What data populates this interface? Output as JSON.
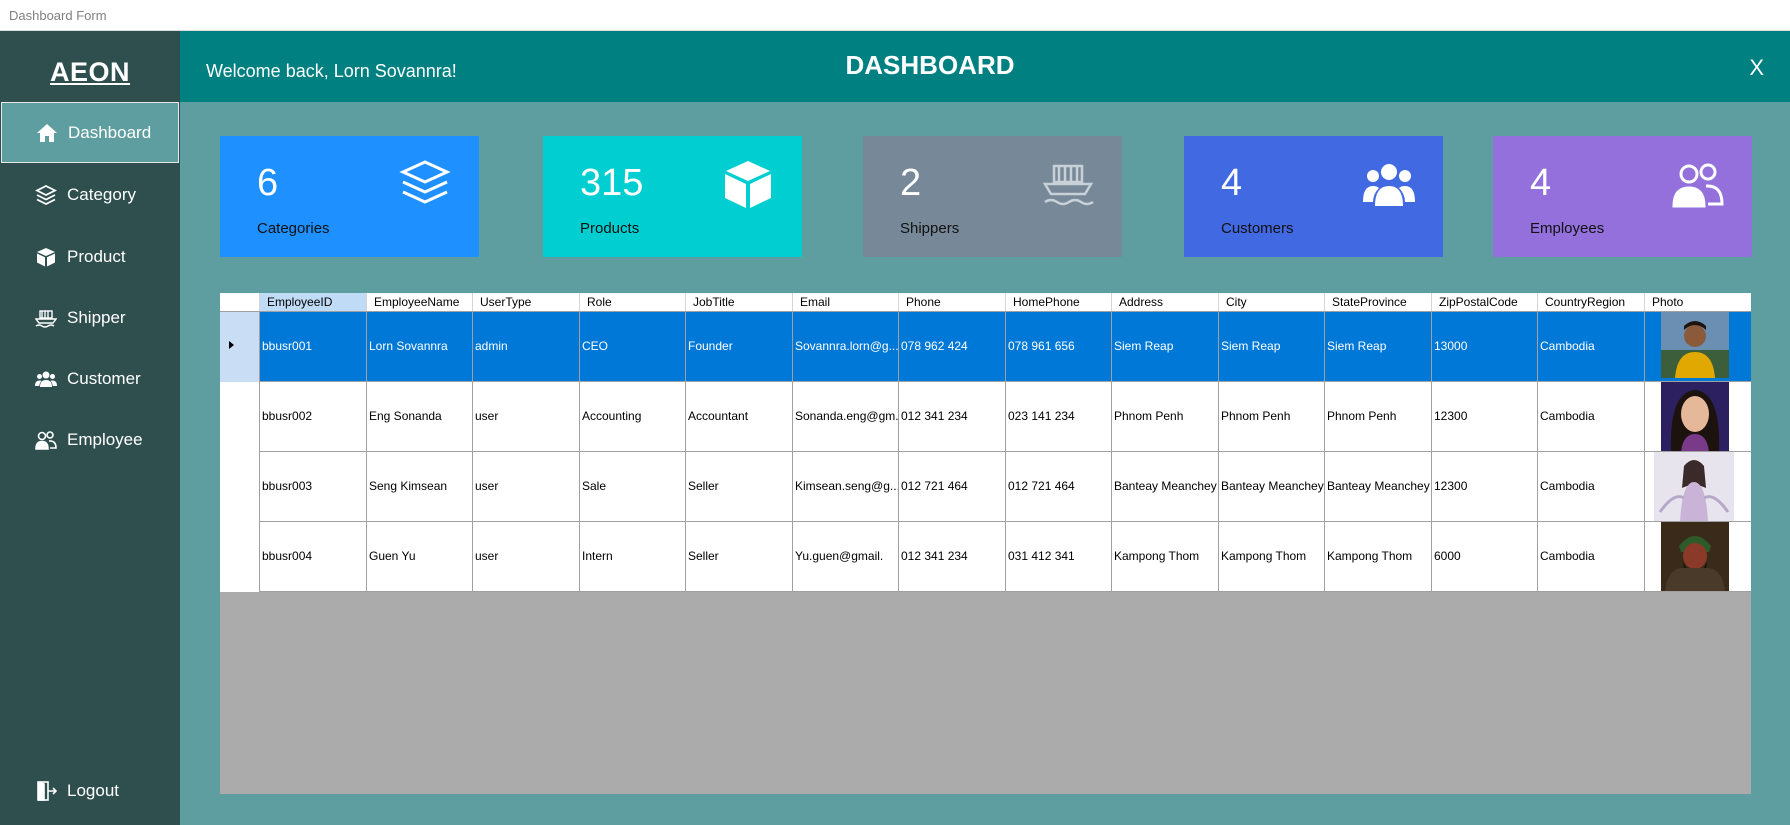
{
  "window": {
    "title": "Dashboard Form"
  },
  "sidebar": {
    "logo": "AEON",
    "items": [
      {
        "label": "Dashboard",
        "icon": "home-icon",
        "active": true
      },
      {
        "label": "Category",
        "icon": "layers-icon"
      },
      {
        "label": "Product",
        "icon": "box-icon"
      },
      {
        "label": "Shipper",
        "icon": "ship-icon"
      },
      {
        "label": "Customer",
        "icon": "users-icon"
      },
      {
        "label": "Employee",
        "icon": "employee-icon"
      }
    ],
    "logout": {
      "label": "Logout",
      "icon": "logout-icon"
    }
  },
  "header": {
    "welcome": "Welcome back, Lorn Sovannra!",
    "title": "DASHBOARD",
    "close": "X"
  },
  "cards": [
    {
      "value": "6",
      "label": "Categories",
      "color": "#1e90ff",
      "icon": "layers-icon"
    },
    {
      "value": "315",
      "label": "Products",
      "color": "#00ced1",
      "icon": "box-icon"
    },
    {
      "value": "2",
      "label": "Shippers",
      "color": "#778899",
      "icon": "ship-icon"
    },
    {
      "value": "4",
      "label": "Customers",
      "color": "#4169e1",
      "icon": "users-icon"
    },
    {
      "value": "4",
      "label": "Employees",
      "color": "#9370db",
      "icon": "employee-icon"
    }
  ],
  "table": {
    "columns": [
      "EmployeeID",
      "EmployeeName",
      "UserType",
      "Role",
      "JobTitle",
      "Email",
      "Phone",
      "HomePhone",
      "Address",
      "City",
      "StateProvince",
      "ZipPostalCode",
      "CountryRegion",
      "Photo"
    ],
    "rows": [
      [
        "bbusr001",
        "Lorn Sovannra",
        "admin",
        "CEO",
        "Founder",
        "Sovannra.lorn@g...",
        "078 962 424",
        "078 961 656",
        "Siem Reap",
        "Siem Reap",
        "Siem Reap",
        "13000",
        "Cambodia",
        "photo-man"
      ],
      [
        "bbusr002",
        "Eng Sonanda",
        "user",
        "Accounting",
        "Accountant",
        "Sonanda.eng@gm...",
        "012 341 234",
        "023 141 234",
        "Phnom Penh",
        "Phnom Penh",
        "Phnom Penh",
        "12300",
        "Cambodia",
        "photo-woman"
      ],
      [
        "bbusr003",
        "Seng Kimsean",
        "user",
        "Sale",
        "Seller",
        "Kimsean.seng@g...",
        "012 721 464",
        "012 721 464",
        "Banteay Meanchey",
        "Banteay Meanchey",
        "Banteay Meanchey",
        "12300",
        "Cambodia",
        "photo-illustration"
      ],
      [
        "bbusr004",
        "Guen Yu",
        "user",
        "Intern",
        "Seller",
        "Yu.guen@gmail.",
        "012 341 234",
        "031 412 341",
        "Kampong Thom",
        "Kampong Thom",
        "Kampong Thom",
        "6000",
        "Cambodia",
        "photo-warrior"
      ]
    ],
    "selected_row": 0
  }
}
